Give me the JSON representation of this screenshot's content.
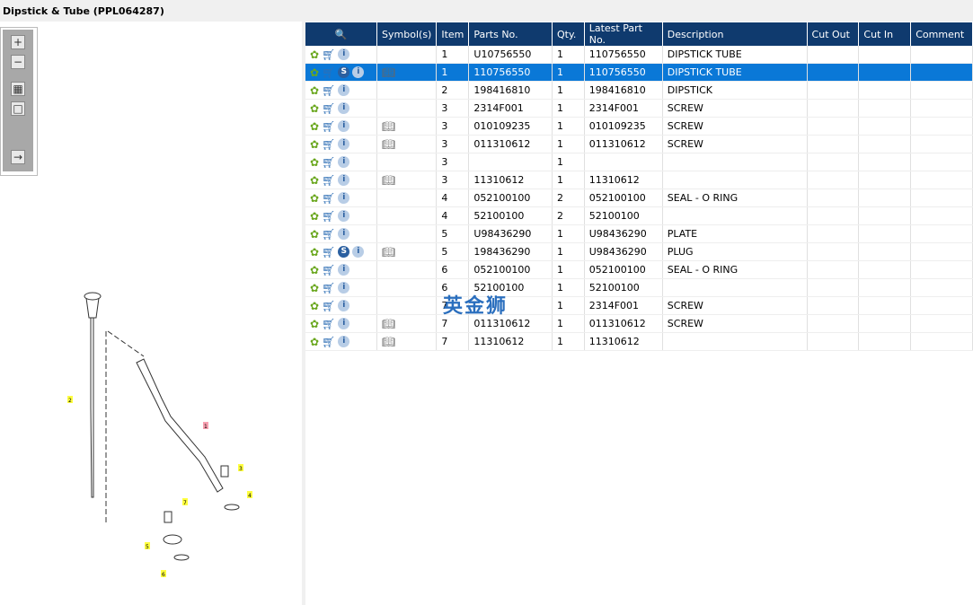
{
  "title": "Dipstick & Tube (PPL064287)",
  "toolbar": [
    "zoom-in",
    "zoom-out",
    "fit-all",
    "fit-window",
    "export"
  ],
  "columns": [
    "",
    "Symbol(s)",
    "Item",
    "Parts No.",
    "Qty.",
    "Latest Part No.",
    "Description",
    "Cut Out",
    "Cut In",
    "Comment"
  ],
  "rows": [
    {
      "s": false,
      "sym": false,
      "item": "1",
      "part": "U10756550",
      "qty": "1",
      "latest": "110756550",
      "desc": "DIPSTICK TUBE"
    },
    {
      "s": true,
      "sym": true,
      "item": "1",
      "part": "110756550",
      "qty": "1",
      "latest": "110756550",
      "desc": "DIPSTICK TUBE",
      "selected": true
    },
    {
      "s": false,
      "sym": false,
      "item": "2",
      "part": "198416810",
      "qty": "1",
      "latest": "198416810",
      "desc": "DIPSTICK"
    },
    {
      "s": false,
      "sym": false,
      "item": "3",
      "part": "2314F001",
      "qty": "1",
      "latest": "2314F001",
      "desc": "SCREW"
    },
    {
      "s": false,
      "sym": true,
      "item": "3",
      "part": "010109235",
      "qty": "1",
      "latest": "010109235",
      "desc": "SCREW"
    },
    {
      "s": false,
      "sym": true,
      "item": "3",
      "part": "011310612",
      "qty": "1",
      "latest": "011310612",
      "desc": "SCREW"
    },
    {
      "s": false,
      "sym": false,
      "item": "3",
      "part": "",
      "qty": "1",
      "latest": "",
      "desc": ""
    },
    {
      "s": false,
      "sym": true,
      "item": "3",
      "part": "11310612",
      "qty": "1",
      "latest": "11310612",
      "desc": ""
    },
    {
      "s": false,
      "sym": false,
      "item": "4",
      "part": "052100100",
      "qty": "2",
      "latest": "052100100",
      "desc": "SEAL - O RING"
    },
    {
      "s": false,
      "sym": false,
      "item": "4",
      "part": "52100100",
      "qty": "2",
      "latest": "52100100",
      "desc": ""
    },
    {
      "s": false,
      "sym": false,
      "item": "5",
      "part": "U98436290",
      "qty": "1",
      "latest": "U98436290",
      "desc": "PLATE"
    },
    {
      "s": true,
      "sym": true,
      "item": "5",
      "part": "198436290",
      "qty": "1",
      "latest": "U98436290",
      "desc": "PLUG"
    },
    {
      "s": false,
      "sym": false,
      "item": "6",
      "part": "052100100",
      "qty": "1",
      "latest": "052100100",
      "desc": "SEAL - O RING"
    },
    {
      "s": false,
      "sym": false,
      "item": "6",
      "part": "52100100",
      "qty": "1",
      "latest": "52100100",
      "desc": ""
    },
    {
      "s": false,
      "sym": false,
      "item": "7",
      "part": "",
      "qty": "1",
      "latest": "2314F001",
      "desc": "SCREW"
    },
    {
      "s": false,
      "sym": true,
      "item": "7",
      "part": "011310612",
      "qty": "1",
      "latest": "011310612",
      "desc": "SCREW"
    },
    {
      "s": false,
      "sym": true,
      "item": "7",
      "part": "11310612",
      "qty": "1",
      "latest": "11310612",
      "desc": ""
    }
  ],
  "callouts": [
    "1",
    "2",
    "3",
    "4",
    "5",
    "6",
    "7"
  ],
  "watermark": "英金狮"
}
